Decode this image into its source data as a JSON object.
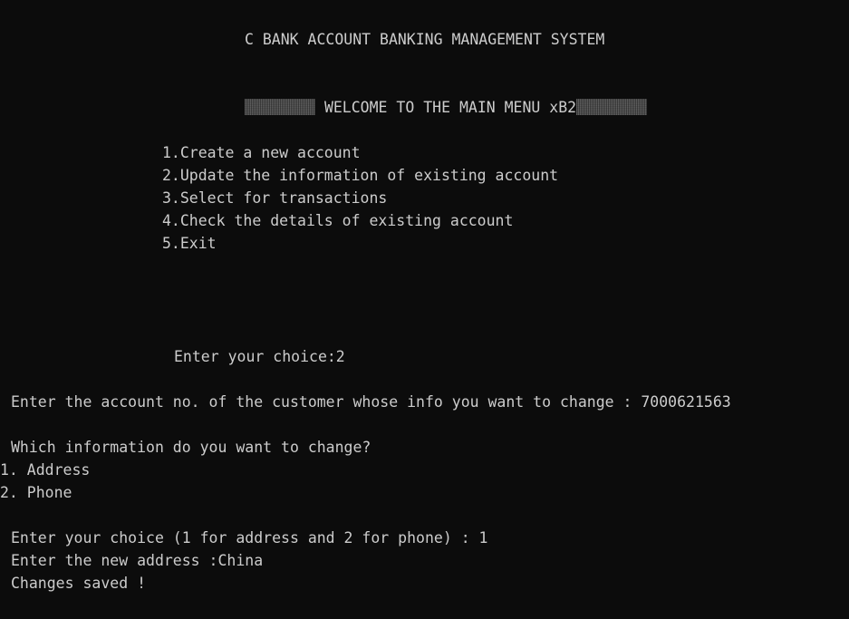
{
  "console": {
    "title": "C BANK ACCOUNT BANKING MANAGEMENT SYSTEM",
    "welcome": "WELCOME TO THE MAIN MENU xB2",
    "menu": [
      "1.Create a new account",
      "2.Update the information of existing account",
      "3.Select for transactions",
      "4.Check the details of existing account",
      "5.Exit"
    ],
    "choice_prompt": "Enter your choice:2",
    "account_prompt": "Enter the account no. of the customer whose info you want to change : 7000621563",
    "which_info": "Which information do you want to change?",
    "options": [
      "1. Address",
      "2. Phone"
    ],
    "option_choice": "Enter your choice (1 for address and 2 for phone) : 1",
    "new_address": "Enter the new address :China",
    "saved": "Changes saved !"
  },
  "colors": {
    "background": "#0c0c0c",
    "text": "#cccccc"
  }
}
